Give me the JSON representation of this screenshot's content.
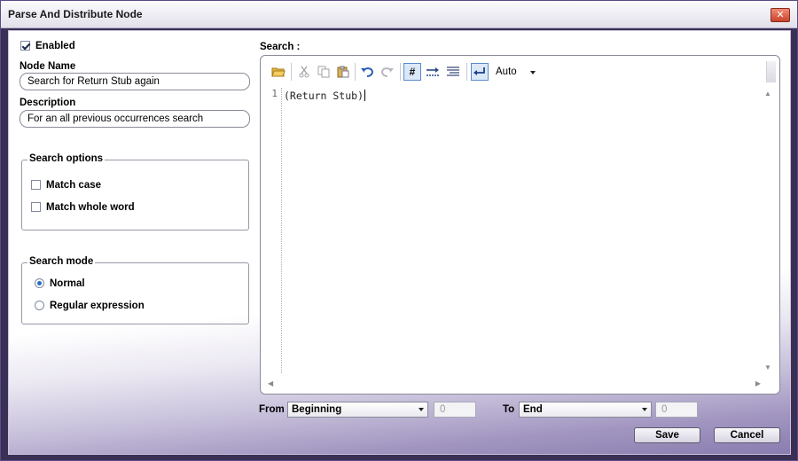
{
  "window": {
    "title": "Parse And Distribute Node",
    "close_glyph": "✕"
  },
  "left": {
    "enabled": {
      "label": "Enabled",
      "checked": true
    },
    "node_name": {
      "label": "Node Name",
      "value": "Search for Return Stub again"
    },
    "description": {
      "label": "Description",
      "value": "For an all previous occurrences search"
    },
    "search_options": {
      "title": "Search options",
      "items": [
        {
          "label": "Match case",
          "checked": false
        },
        {
          "label": "Match whole word",
          "checked": false
        }
      ]
    },
    "search_mode": {
      "title": "Search mode",
      "items": [
        {
          "label": "Normal",
          "selected": true
        },
        {
          "label": "Regular expression",
          "selected": false
        }
      ]
    }
  },
  "search": {
    "label": "Search :",
    "toolbar": {
      "icons": [
        "open-folder-icon",
        "cut-icon",
        "copy-icon",
        "paste-icon",
        "undo-icon",
        "redo-icon",
        "line-numbers-icon",
        "tab-icon",
        "indent-icon",
        "word-wrap-icon"
      ],
      "mode_value": "Auto"
    },
    "lines": [
      {
        "number": "1",
        "text": "(Return Stub)"
      }
    ]
  },
  "range": {
    "from_label": "From",
    "from_value": "Beginning",
    "from_offset": "0",
    "to_label": "To",
    "to_value": "End",
    "to_offset": "0"
  },
  "buttons": {
    "save": "Save",
    "cancel": "Cancel"
  },
  "colors": {
    "accent": "#2a6bc4",
    "frame": "#3a3056"
  }
}
